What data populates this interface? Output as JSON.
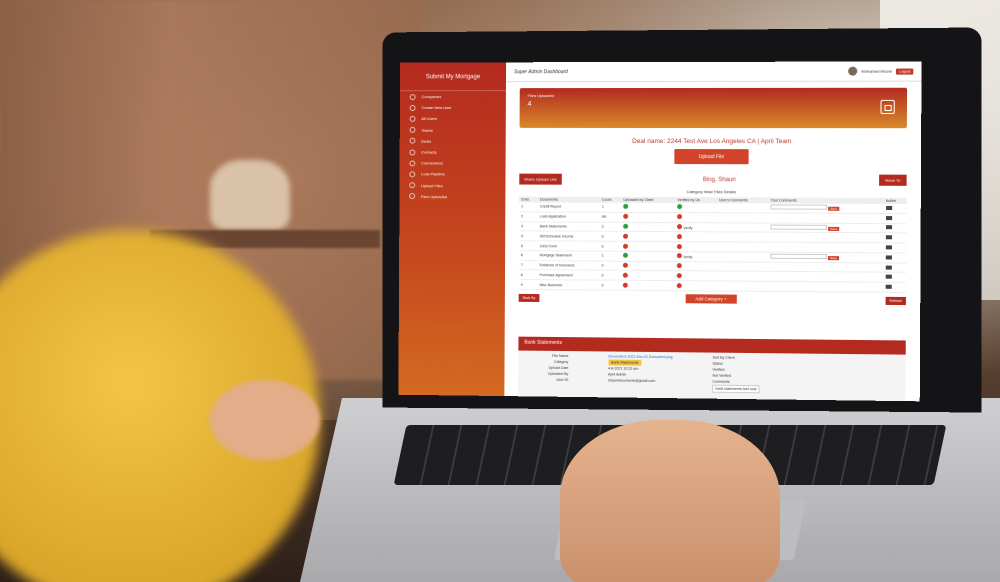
{
  "app": {
    "brand": "Submit My Mortgage",
    "dashboard_title": "Super Admin Dashboard"
  },
  "user": {
    "name": "Mohamed Moore",
    "logout": "Logout"
  },
  "sidebar": {
    "items": [
      "Companies",
      "Create New User",
      "All Users",
      "Teams",
      "Deals",
      "Contacts",
      "Connections",
      "Loan Pipeline",
      "Upload Files",
      "Files Uploaded"
    ]
  },
  "files_card": {
    "label": "Files Uploaded",
    "count": "4"
  },
  "deal": {
    "name": "Deal name: 2244 Test Ave Los Angeles CA | April Team",
    "upload_label": "Upload File"
  },
  "controls": {
    "share_label": "Share Upload Link",
    "client_name": "Bing, Shaun",
    "move_label": "Move To"
  },
  "table": {
    "title": "Category Wise Files Details",
    "headers": [
      "S.No",
      "Documents",
      "Count",
      "Uploaded by Client",
      "Verified by Us",
      "User's Comments",
      "Your Comments",
      "Action"
    ],
    "rows": [
      {
        "no": "1",
        "doc": "Credit Report",
        "count": "1",
        "client": "ok",
        "verified": "ok"
      },
      {
        "no": "2",
        "doc": "Loan Application",
        "count": "Nh",
        "client": "no",
        "verified": "no"
      },
      {
        "no": "3",
        "doc": "Bank Statements",
        "count": "2",
        "client": "ok",
        "verified": "no",
        "verify": "Verify"
      },
      {
        "no": "4",
        "doc": "W2/Schedule Income",
        "count": "0",
        "client": "no",
        "verified": "no"
      },
      {
        "no": "5",
        "doc": "1003 Form",
        "count": "0",
        "client": "no",
        "verified": "no"
      },
      {
        "no": "6",
        "doc": "Mortgage Statement",
        "count": "1",
        "client": "ok",
        "verified": "no",
        "verify": "Verify"
      },
      {
        "no": "7",
        "doc": "Evidence of Insurance",
        "count": "0",
        "client": "no",
        "verified": "no"
      },
      {
        "no": "8",
        "doc": "Purchase Agreement",
        "count": "0",
        "client": "no",
        "verified": "no"
      },
      {
        "no": "9",
        "doc": "Misc Business",
        "count": "0",
        "client": "no",
        "verified": "no"
      }
    ],
    "save_label": "Save"
  },
  "bottom": {
    "back_label": "Back By",
    "add_category": "Add Category +",
    "refresh_label": "Refresh"
  },
  "section": {
    "title": "Bank Statements"
  },
  "details": {
    "labels": [
      "File Name",
      "Category",
      "Upload Date",
      "Uploaded By",
      "User ID"
    ],
    "values": [
      "Screenshot-2021-Dec-01 Document.png",
      "Bank Statements",
      "4-8-2021 10:23 am",
      "April Admin",
      "shaundocuments@gmail.com"
    ],
    "right": {
      "sort_label": "Sort By Client",
      "status_label": "Status",
      "verified": "Verified",
      "not_verified": "Not Verified",
      "comments_label": "Comments",
      "comment_value": "bank statements test note"
    }
  }
}
